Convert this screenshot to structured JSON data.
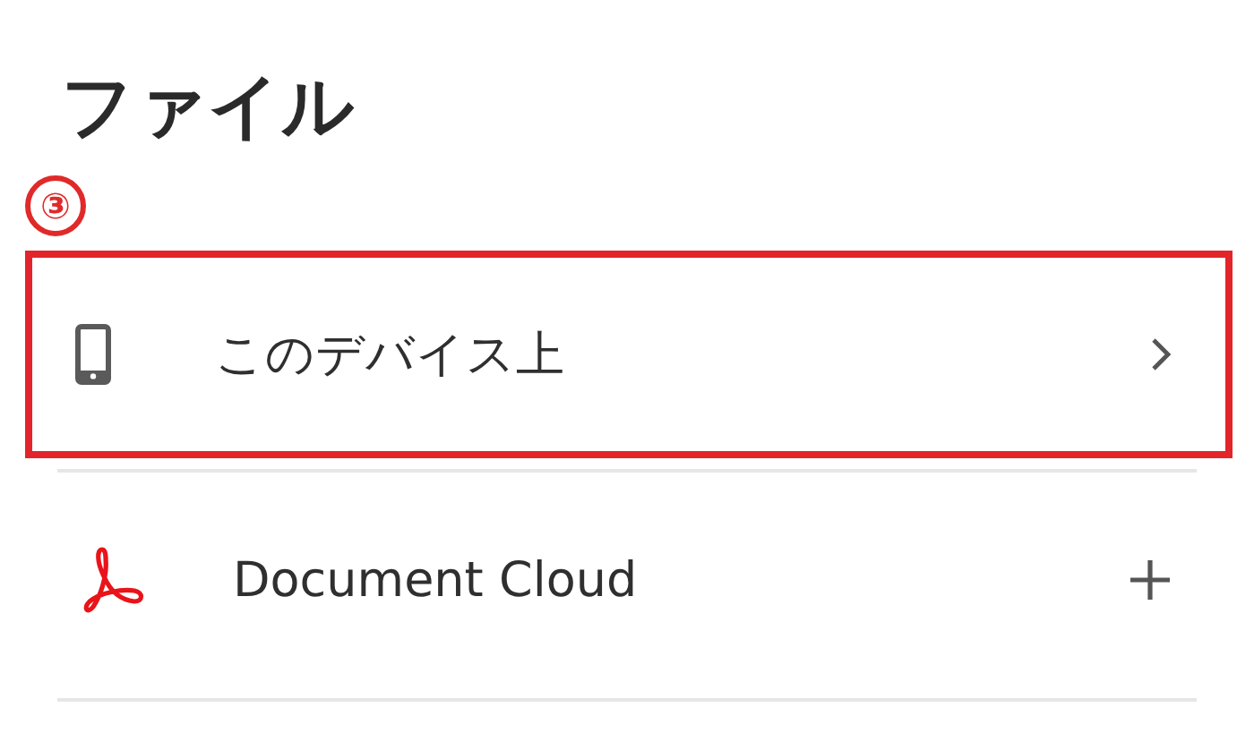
{
  "title": "ファイル",
  "annotation": "③",
  "items": [
    {
      "label": "このデバイス上",
      "kind": "device",
      "highlighted": true
    },
    {
      "label": "Document Cloud",
      "kind": "cloud",
      "highlighted": false
    }
  ]
}
